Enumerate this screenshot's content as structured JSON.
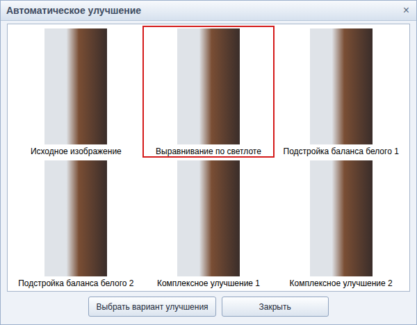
{
  "window": {
    "title": "Автоматическое улучшение",
    "close": "×"
  },
  "variants": [
    {
      "caption": "Исходное изображение",
      "selected": false
    },
    {
      "caption": "Выравнивание по светлоте",
      "selected": true
    },
    {
      "caption": "Подстройка баланса белого 1",
      "selected": false
    },
    {
      "caption": "Подстройка баланса белого 2",
      "selected": false
    },
    {
      "caption": "Комплексное улучшение 1",
      "selected": false
    },
    {
      "caption": "Комплексное улучшение 2",
      "selected": false
    }
  ],
  "buttons": [
    "Выбрать вариант улучшения",
    "Закрыть"
  ]
}
